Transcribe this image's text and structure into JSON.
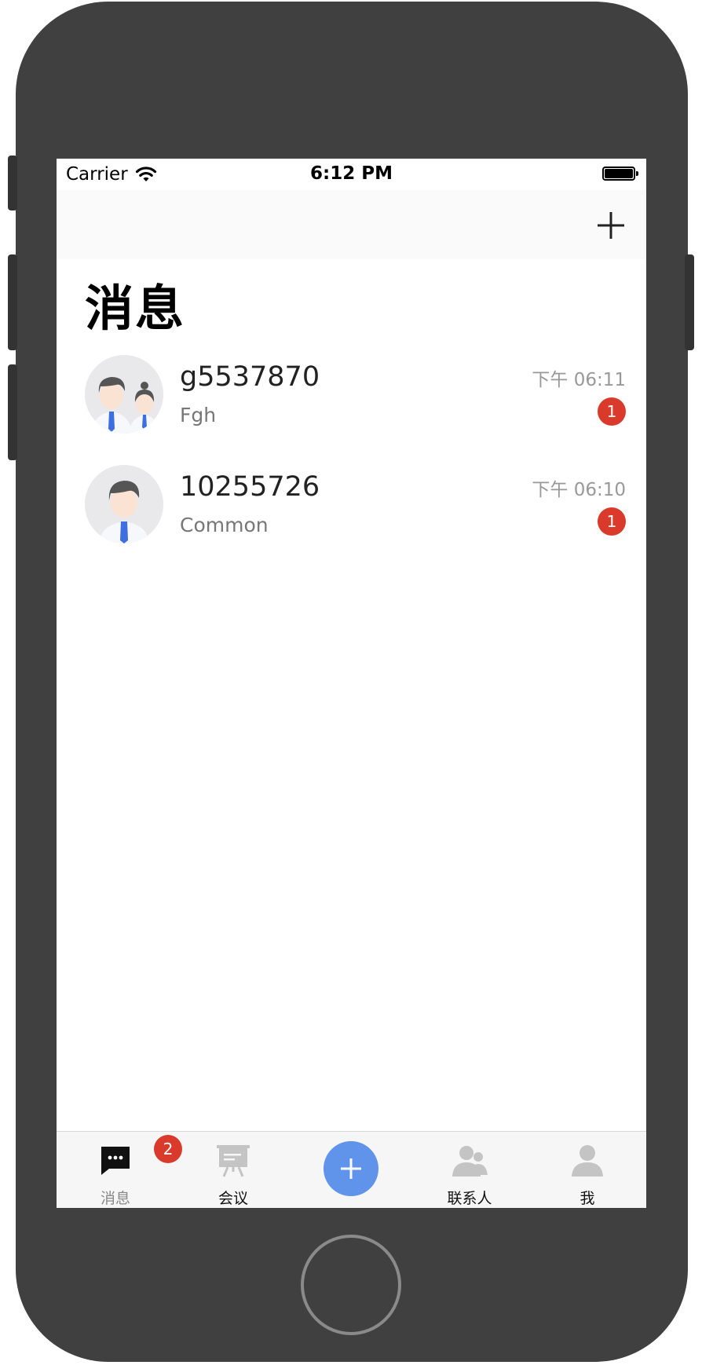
{
  "status_bar": {
    "carrier": "Carrier",
    "time": "6:12 PM",
    "wifi_icon": "wifi-icon",
    "battery_icon": "battery-full-icon"
  },
  "navbar": {
    "add_icon": "plus-icon"
  },
  "page": {
    "title": "消息"
  },
  "conversations": [
    {
      "name": "g5537870",
      "preview": "Fgh",
      "time": "下午 06:11",
      "unread": "1",
      "avatar": "group-avatar-icon"
    },
    {
      "name": "10255726",
      "preview": "Common",
      "time": "下午 06:10",
      "unread": "1",
      "avatar": "user-avatar-icon"
    }
  ],
  "tabbar": {
    "messages": {
      "label": "消息",
      "badge": "2",
      "icon": "chat-bubble-icon"
    },
    "meetings": {
      "label": "会议",
      "icon": "presentation-board-icon"
    },
    "center": {
      "icon": "plus-icon"
    },
    "contacts": {
      "label": "联系人",
      "icon": "contacts-icon"
    },
    "me": {
      "label": "我",
      "icon": "person-icon"
    }
  },
  "colors": {
    "accent": "#5f94ea",
    "badge": "#d93a2b",
    "device": "#404040"
  }
}
